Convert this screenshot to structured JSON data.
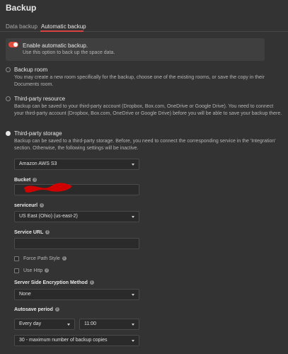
{
  "page": {
    "title": "Backup"
  },
  "tabs": [
    {
      "label": "Data backup",
      "active": false
    },
    {
      "label": "Automatic backup",
      "active": true
    }
  ],
  "auto_backup": {
    "title": "Enable automatic backup.",
    "description": "Use this option to back up the space data.",
    "enabled": true
  },
  "options": {
    "backup_room": {
      "title": "Backup room",
      "description": "You may create a new room specifically for the backup, choose one of the existing rooms, or save the copy in their Documents room.",
      "selected": false
    },
    "third_party_resource": {
      "title": "Third-party resource",
      "description": "Backup can be saved to your third-party account (Dropbox, Box.com, OneDrive or Google Drive). You need to connect your third-party account (Dropbox, Box.com, OneDrive or Google Drive) before you will be able to save your backup there.",
      "selected": false
    },
    "third_party_storage": {
      "title": "Third-party storage",
      "description": "Backup can be saved to a third-party storage. Before, you need to connect the corresponding service in the 'Integration' section. Otherwise, the following settings will be inactive.",
      "selected": true
    }
  },
  "storage": {
    "provider": "Amazon AWS S3",
    "bucket_label": "Bucket",
    "bucket_value": "",
    "serviceurl_label": "serviceurl",
    "serviceurl_value": "US East (Ohio) (us-east-2)",
    "service_url_label": "Service URL",
    "service_url_value": "",
    "force_path_style_label": "Force Path Style",
    "use_http_label": "Use Http",
    "encryption_label": "Server Side Encryption Method",
    "encryption_value": "None",
    "autosave_label": "Autosave period",
    "period_value": "Every day",
    "time_value": "11:00",
    "max_copies_value": "30 - maximum number of backup copies"
  },
  "icons": {
    "info": "info-icon",
    "caret": "chevron-down-icon",
    "accent_color": "#e34b3c"
  }
}
